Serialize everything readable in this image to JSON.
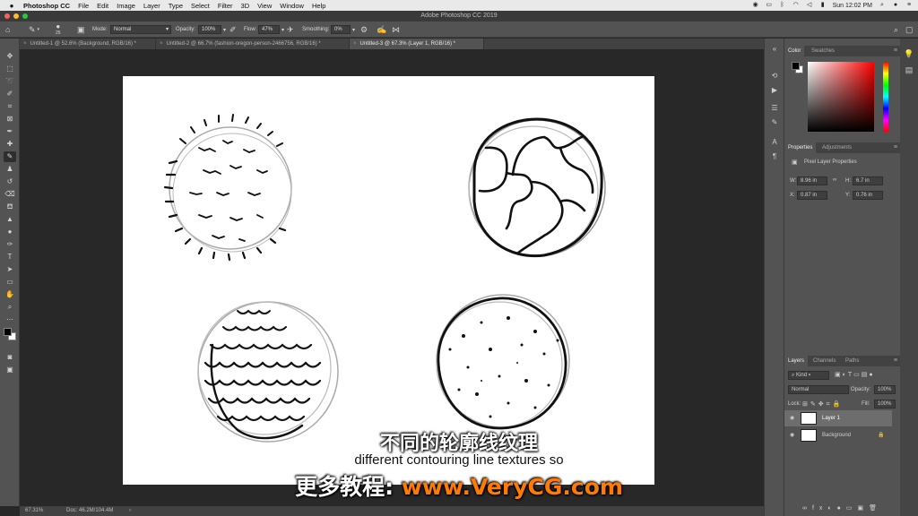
{
  "menubar": {
    "app_name": "Photoshop CC",
    "menus": [
      "File",
      "Edit",
      "Image",
      "Layer",
      "Type",
      "Select",
      "Filter",
      "3D",
      "View",
      "Window",
      "Help"
    ],
    "clock": "Sun 12:02 PM"
  },
  "window": {
    "title": "Adobe Photoshop CC 2019"
  },
  "options_bar": {
    "brush_size": "25",
    "mode_label": "Mode:",
    "mode_value": "Normal",
    "opacity_label": "Opacity:",
    "opacity_value": "100%",
    "flow_label": "Flow:",
    "flow_value": "47%",
    "smoothing_label": "Smoothing:",
    "smoothing_value": "0%"
  },
  "tabs": [
    {
      "label": "Untitled-1 @ 52.6% (Background, RGB/16) *"
    },
    {
      "label": "Untitled-2 @ 66.7% (fashion-oregon-person-2466756, RGB/16) *"
    },
    {
      "label": "Untitled-3 @ 67.3% (Layer 1, RGB/16) *",
      "active": true
    }
  ],
  "status": {
    "zoom": "67.31%",
    "doc": "Doc: 46.2M/104.4M"
  },
  "panels": {
    "color_tabs": [
      "Color",
      "Swatches"
    ],
    "properties_tabs": [
      "Properties",
      "Adjustments"
    ],
    "properties_title": "Pixel Layer Properties",
    "w_label": "W:",
    "w_value": "8.96 in",
    "h_label": "H:",
    "h_value": "6.7 in",
    "x_label": "X:",
    "x_value": "0.87 in",
    "y_label": "Y:",
    "y_value": "0.76 in",
    "layers_tabs": [
      "Layers",
      "Channels",
      "Paths"
    ],
    "kind_label": "Kind",
    "blend_mode": "Normal",
    "opacity_label": "Opacity:",
    "opacity_value": "100%",
    "lock_label": "Lock:",
    "fill_label": "Fill:",
    "fill_value": "100%",
    "layers": [
      {
        "name": "Layer 1",
        "selected": true
      },
      {
        "name": "Background",
        "locked": true
      }
    ]
  },
  "subtitles": {
    "chinese": "不同的轮廓线纹理",
    "english": "different contouring line textures so",
    "ad_prefix": "更多教程: ",
    "ad_url": "www.VeryCG.com"
  },
  "colors": {
    "foreground": "#000000",
    "background": "#ffffff",
    "accent_red": "#ff0000"
  }
}
